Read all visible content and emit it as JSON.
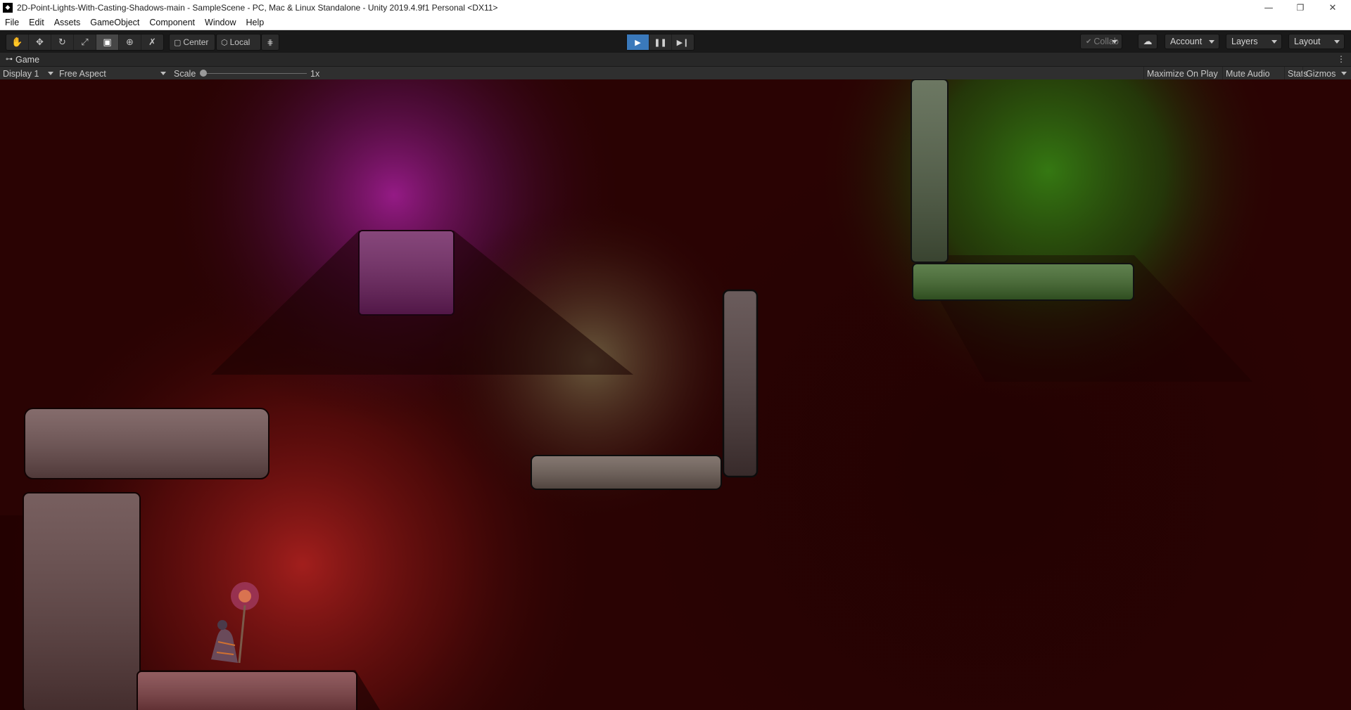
{
  "window": {
    "title": "2D-Point-Lights-With-Casting-Shadows-main - SampleScene - PC, Mac & Linux Standalone - Unity 2019.4.9f1 Personal <DX11>",
    "controls": [
      "minimize-icon",
      "maximize-icon",
      "close-icon"
    ]
  },
  "menu": [
    "File",
    "Edit",
    "Assets",
    "GameObject",
    "Component",
    "Window",
    "Help"
  ],
  "toolbar": {
    "tools": [
      "hand-tool-icon",
      "move-tool-icon",
      "rotate-tool-icon",
      "scale-tool-icon",
      "rect-tool-icon",
      "transform-tool-icon",
      "custom-tool-icon"
    ],
    "active_tool": "rect-tool-icon",
    "pivot_mode": "Center",
    "pivot_rotation": "Local",
    "playback": [
      "play-icon",
      "pause-icon",
      "step-icon"
    ],
    "playing": true,
    "collab": "Collab",
    "account": "Account",
    "layers": "Layers",
    "layout": "Layout"
  },
  "game_view": {
    "tab_label": "Game",
    "display": "Display 1",
    "aspect": "Free Aspect",
    "scale_label": "Scale",
    "scale_value": "1x",
    "maximize_on_play": "Maximize On Play",
    "mute_audio": "Mute Audio",
    "stats": "Stats",
    "gizmos": "Gizmos"
  },
  "colors": {
    "scene_background": "#2a0303",
    "purple_light": "#8e1a82",
    "green_light": "#2d6a12",
    "red_light": "#a41a1a",
    "torch_light": "#6a5a3c",
    "play_active": "#3a79bb"
  }
}
